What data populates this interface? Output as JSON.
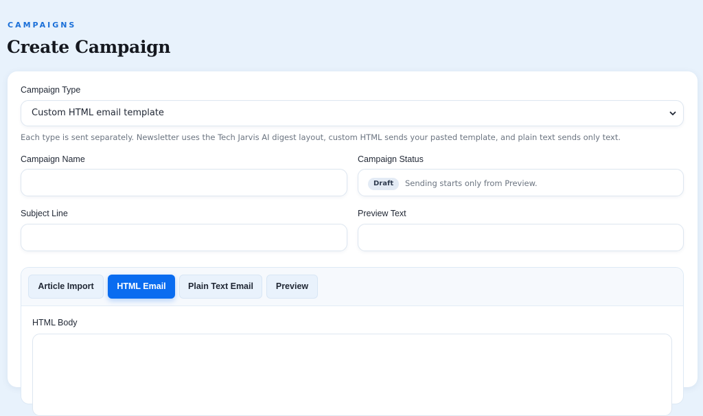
{
  "header": {
    "eyebrow": "CAMPAIGNS",
    "title": "Create Campaign"
  },
  "form": {
    "campaign_type": {
      "label": "Campaign Type",
      "selected": "Custom HTML email template",
      "helper": "Each type is sent separately. Newsletter uses the Tech Jarvis AI digest layout, custom HTML sends your pasted template, and plain text sends only text."
    },
    "campaign_name": {
      "label": "Campaign Name",
      "value": ""
    },
    "campaign_status": {
      "label": "Campaign Status",
      "badge": "Draft",
      "note": "Sending starts only from Preview."
    },
    "subject_line": {
      "label": "Subject Line",
      "value": ""
    },
    "preview_text": {
      "label": "Preview Text",
      "value": ""
    }
  },
  "editor": {
    "tabs": [
      {
        "label": "Article Import",
        "active": false
      },
      {
        "label": "HTML Email",
        "active": true
      },
      {
        "label": "Plain Text Email",
        "active": false
      },
      {
        "label": "Preview",
        "active": false
      }
    ],
    "body_label": "HTML Body",
    "body_value": ""
  },
  "colors": {
    "accent": "#0a6cf0",
    "page_background": "#e8f2fc",
    "eyebrow": "#1a6fd8"
  },
  "icons": {
    "select_chevron": "chevron-down-icon"
  }
}
